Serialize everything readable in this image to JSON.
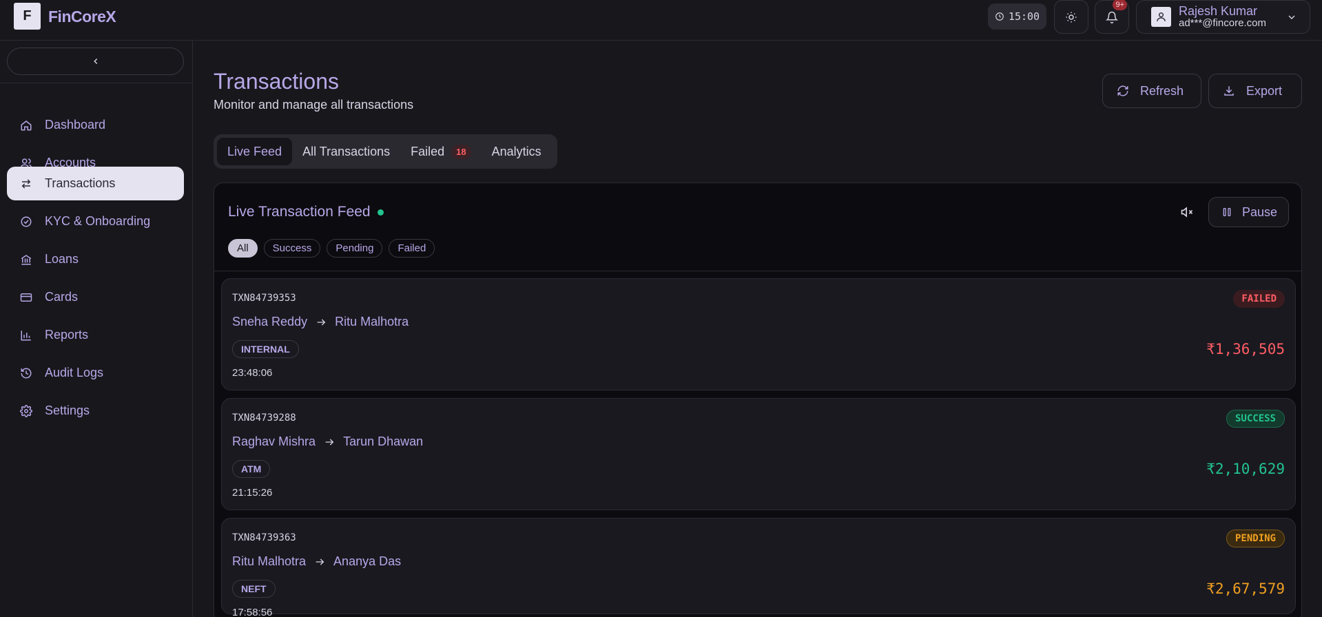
{
  "app": {
    "logo_letter": "F",
    "name": "FinCoreX"
  },
  "header": {
    "clock": "15:00",
    "notif_badge": "9+",
    "user_name": "Rajesh Kumar",
    "user_email": "ad***@fincore.com"
  },
  "sidebar": {
    "items": [
      {
        "label": "Dashboard",
        "icon": "home-icon",
        "active": false
      },
      {
        "label": "Accounts",
        "icon": "users-icon",
        "active": false
      },
      {
        "label": "Transactions",
        "icon": "arrows-icon",
        "active": true
      },
      {
        "label": "KYC & Onboarding",
        "icon": "check-circle-icon",
        "active": false
      },
      {
        "label": "Loans",
        "icon": "bank-icon",
        "active": false
      },
      {
        "label": "Cards",
        "icon": "card-icon",
        "active": false
      },
      {
        "label": "Reports",
        "icon": "chart-icon",
        "active": false
      },
      {
        "label": "Audit Logs",
        "icon": "history-icon",
        "active": false
      },
      {
        "label": "Settings",
        "icon": "gear-icon",
        "active": false
      }
    ]
  },
  "page": {
    "title": "Transactions",
    "subtitle": "Monitor and manage all transactions",
    "refresh_label": "Refresh",
    "export_label": "Export"
  },
  "tabs": {
    "live": "Live Feed",
    "all": "All Transactions",
    "failed": "Failed",
    "failed_count": "18",
    "analytics": "Analytics"
  },
  "feed": {
    "title": "Live Transaction Feed",
    "pause_label": "Pause",
    "filters": {
      "all": "All",
      "success": "Success",
      "pending": "Pending",
      "failed": "Failed"
    }
  },
  "transactions": [
    {
      "id": "TXN84739353",
      "from": "Sneha Reddy",
      "to": "Ritu Malhotra",
      "type": "INTERNAL",
      "time": "23:48:06",
      "status": "FAILED",
      "amount": "₹1,36,505"
    },
    {
      "id": "TXN84739288",
      "from": "Raghav Mishra",
      "to": "Tarun Dhawan",
      "type": "ATM",
      "time": "21:15:26",
      "status": "SUCCESS",
      "amount": "₹2,10,629"
    },
    {
      "id": "TXN84739363",
      "from": "Ritu Malhotra",
      "to": "Ananya Das",
      "type": "NEFT",
      "time": "17:58:56",
      "status": "PENDING",
      "amount": "₹2,67,579"
    }
  ],
  "colors": {
    "accent": "#b7a8e8",
    "failed": "#ff5d65",
    "success": "#22c38e",
    "pending": "#f0a020"
  }
}
